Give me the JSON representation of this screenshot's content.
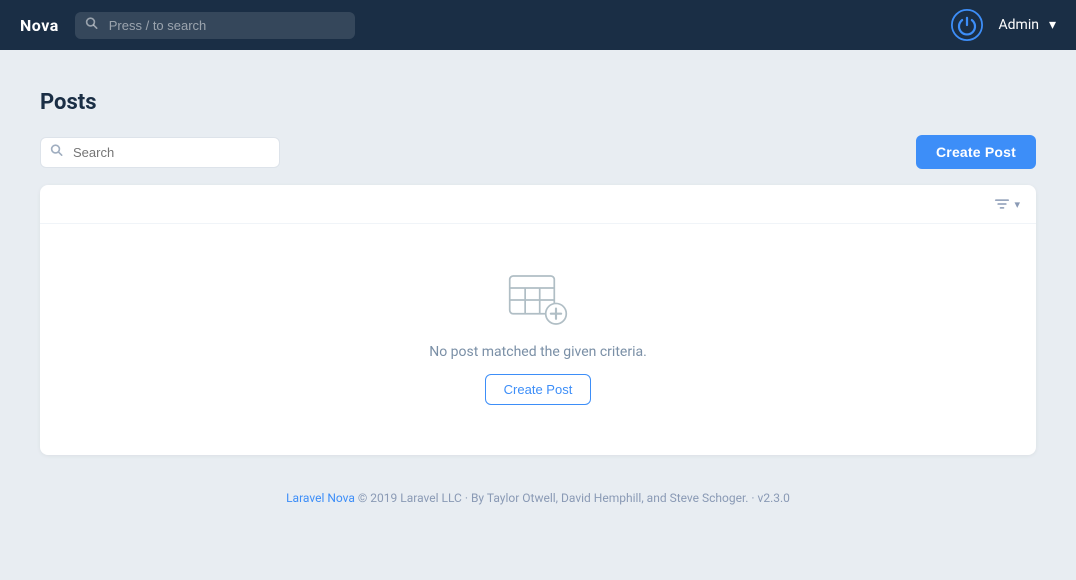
{
  "header": {
    "logo": "Nova",
    "search_placeholder": "Press / to search",
    "user_name": "Admin",
    "user_chevron": "▾"
  },
  "page": {
    "title": "Posts",
    "search_placeholder": "Search",
    "create_button_label": "Create Post",
    "filter_label": "▾",
    "empty_message": "No post matched the given criteria.",
    "empty_create_label": "Create Post"
  },
  "footer": {
    "link_text": "Laravel Nova",
    "copy_text": "© 2019 Laravel LLC · By Taylor Otwell, David Hemphill, and Steve Schoger. · v2.3.0"
  }
}
